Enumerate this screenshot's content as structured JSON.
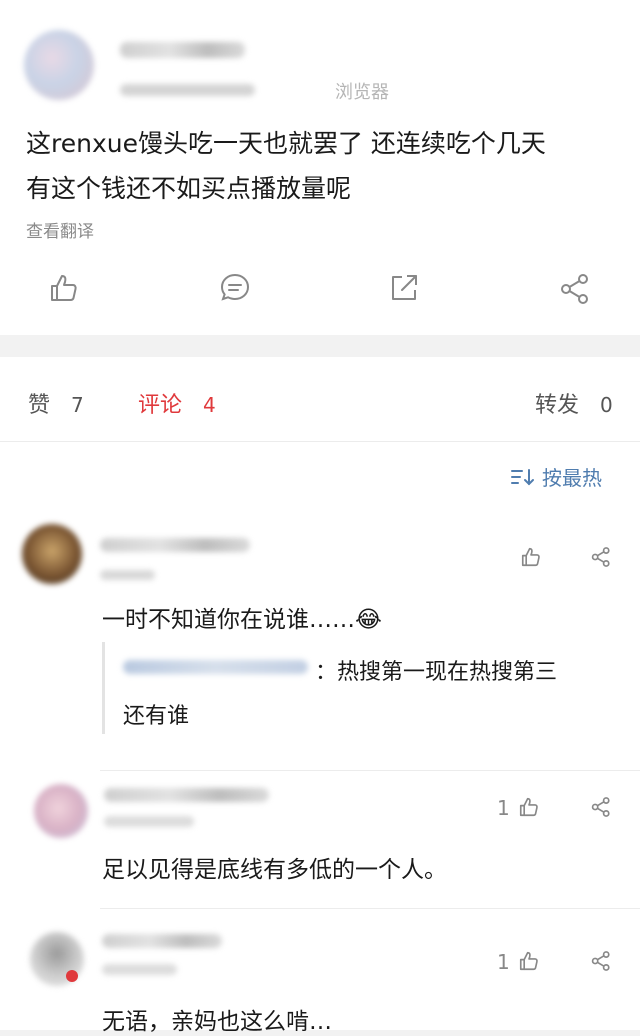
{
  "post": {
    "meta_source": "浏览器",
    "text_line1": "这renxue馒头吃一天也就罢了 还连续吃个几天",
    "text_line2": "有这个钱还不如买点播放量呢",
    "translate_link": "查看翻译"
  },
  "stats_bar": {
    "likes_label": "赞",
    "likes_count": "7",
    "comments_label": "评论",
    "comments_count": "4",
    "reposts_label": "转发",
    "reposts_count": "0"
  },
  "sort": {
    "label": "按最热"
  },
  "comments": [
    {
      "text": "一时不知道你在说谁……😂",
      "like_count": "",
      "reply_text_line1": "：热搜第一现在热搜第三",
      "reply_text_line2": "还有谁"
    },
    {
      "text": "足以见得是底线有多低的一个人。",
      "like_count": "1"
    },
    {
      "text": "无语，亲妈也这么啃…",
      "like_count": "1"
    }
  ],
  "colors": {
    "accent_red": "#e0393c",
    "link_blue": "#507daf",
    "icon_gray": "#888888"
  },
  "icons": [
    "like-icon",
    "comment-icon",
    "repost-icon",
    "share-icon",
    "sort-icon"
  ]
}
